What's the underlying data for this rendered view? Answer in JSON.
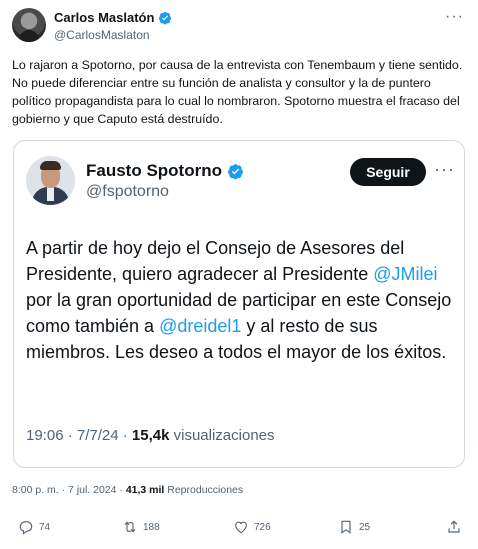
{
  "author": {
    "name": "Carlos Maslatón",
    "handle": "@CarlosMaslaton",
    "more_label": "···"
  },
  "tweet_text": "Lo rajaron a Spotorno, por causa de la entrevista con Tenembaum y tiene sentido. No puede diferenciar entre su función de analista y consultor y la de puntero político propagandista para lo cual lo nombraron. Spotorno muestra el fracaso del gobierno y que Caputo está destruído.",
  "quoted": {
    "name": "Fausto Spotorno",
    "handle": "@fspotorno",
    "follow_label": "Seguir",
    "more_label": "···",
    "text_parts": {
      "p1": "A partir de hoy dejo el Consejo de Asesores del Presidente, quiero agradecer al Presidente ",
      "mention1": "@JMilei",
      "p2": "  por la gran oportunidad de participar en este Consejo como también a ",
      "mention2": "@dreidel1",
      "p3": " y al resto de sus miembros. Les deseo a todos el mayor de los éxitos."
    },
    "time": "19:06 · 7/7/24 · ",
    "views_count": "15,4k",
    "views_label": " visualizaciones"
  },
  "meta": {
    "datetime": "8:00 p. m. · 7 jul. 2024 · ",
    "views_count": "41,3 mil",
    "views_label": " Reproducciones"
  },
  "actions": {
    "replies": "74",
    "retweets": "188",
    "likes": "726",
    "bookmarks": "25"
  },
  "colors": {
    "accent": "#1d9bf0",
    "muted": "#536471",
    "text": "#0f1419",
    "border": "#cfd9de"
  }
}
